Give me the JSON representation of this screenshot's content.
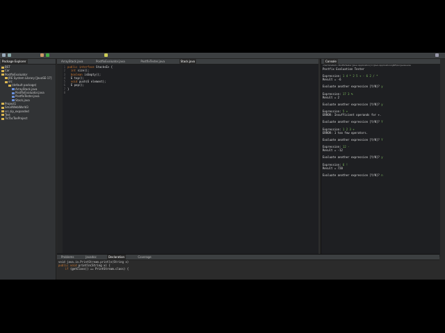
{
  "package_explorer": {
    "title": "Package Explorer",
    "items": [
      {
        "label": "BST",
        "depth": 0
      },
      {
        "label": "Car",
        "depth": 0
      },
      {
        "label": "PostfixEvaluator",
        "depth": 0
      },
      {
        "label": "JRE System Library [JavaSE-17]",
        "depth": 1
      },
      {
        "label": "src",
        "depth": 1
      },
      {
        "label": "(default package)",
        "depth": 2
      },
      {
        "label": "ArrayStack.java",
        "depth": 3
      },
      {
        "label": "PostfixEvaluator.java",
        "depth": 3
      },
      {
        "label": "PostfixTester.java",
        "depth": 3
      },
      {
        "label": "Stack.java",
        "depth": 3
      },
      {
        "label": "Project1",
        "depth": 0
      },
      {
        "label": "SmallWebWorld3",
        "depth": 0
      },
      {
        "label": "src.zip_expanded",
        "depth": 0
      },
      {
        "label": "Test",
        "depth": 0
      },
      {
        "label": "TicTacToeProject",
        "depth": 0
      }
    ]
  },
  "editor": {
    "tabs": [
      "ArrayStack.java",
      "PostfixEvaluator.java",
      "PostfixTester.java",
      "Stack.java"
    ],
    "active_tab": "Stack.java",
    "lines": [
      {
        "n": "1",
        "kw": "public interface ",
        "rest": "Stack<E> {"
      },
      {
        "n": "2",
        "kw": "  int ",
        "rest": "size();"
      },
      {
        "n": "3",
        "kw": "  boolean ",
        "rest": "isEmpty();"
      },
      {
        "n": "4",
        "kw": "",
        "rest": "  E top();"
      },
      {
        "n": "5",
        "kw": "  void ",
        "rest": "push(E element);"
      },
      {
        "n": "6",
        "kw": "",
        "rest": "  E pop();"
      },
      {
        "n": "7",
        "kw": "",
        "rest": "}"
      },
      {
        "n": "8",
        "kw": "",
        "rest": ""
      }
    ]
  },
  "console": {
    "title": "Console",
    "path": "<terminated> PostfixTester [Java Application] C:\\Java Applications\\JRE\\bin\\javaw.exe",
    "lines": [
      {
        "t": "Postfix Evaluation Tester",
        "in": ""
      },
      {
        "t": "",
        "in": ""
      },
      {
        "t": "Expression: ",
        "in": "1 4 * 2 5 + - 6 2 / *"
      },
      {
        "t": "Result = -6",
        "in": ""
      },
      {
        "t": "",
        "in": ""
      },
      {
        "t": "Evaluate another expression [Y/N]? ",
        "in": "y"
      },
      {
        "t": "",
        "in": ""
      },
      {
        "t": "Expression: ",
        "in": "17 3 %"
      },
      {
        "t": "Result = 2",
        "in": ""
      },
      {
        "t": "",
        "in": ""
      },
      {
        "t": "Evaluate another expression [Y/N]? ",
        "in": "y"
      },
      {
        "t": "",
        "in": ""
      },
      {
        "t": "Expression: ",
        "in": "5 +"
      },
      {
        "t": "ERROR: Insufficient operands for +.",
        "in": ""
      },
      {
        "t": "",
        "in": ""
      },
      {
        "t": "Evaluate another expression [Y/N]? ",
        "in": "Y"
      },
      {
        "t": "",
        "in": ""
      },
      {
        "t": "Expression: ",
        "in": "1 2 3 +"
      },
      {
        "t": "ERROR: 1 too few operators.",
        "in": ""
      },
      {
        "t": "",
        "in": ""
      },
      {
        "t": "Evaluate another expression [Y/N]? ",
        "in": "Y"
      },
      {
        "t": "",
        "in": ""
      },
      {
        "t": "Expression: ",
        "in": "12 -"
      },
      {
        "t": "Result = -12",
        "in": ""
      },
      {
        "t": "",
        "in": ""
      },
      {
        "t": "Evaluate another expression [Y/N]? ",
        "in": "y"
      },
      {
        "t": "",
        "in": ""
      },
      {
        "t": "Expression: ",
        "in": "6 !"
      },
      {
        "t": "Result = 720",
        "in": ""
      },
      {
        "t": "",
        "in": ""
      },
      {
        "t": "Evaluate another expression [Y/N]? ",
        "in": "n"
      }
    ]
  },
  "bottom": {
    "tabs": [
      "Problems",
      "Javadoc",
      "Declaration",
      "Coverage"
    ],
    "active_tab": "Declaration",
    "signature": "void java.io.PrintStream.println(String x)",
    "snippet": [
      {
        "kw": "public void ",
        "rest": "println(String x) {"
      },
      {
        "kw": "    if ",
        "rest": "(getClass() == PrintStream.class) {"
      }
    ]
  }
}
